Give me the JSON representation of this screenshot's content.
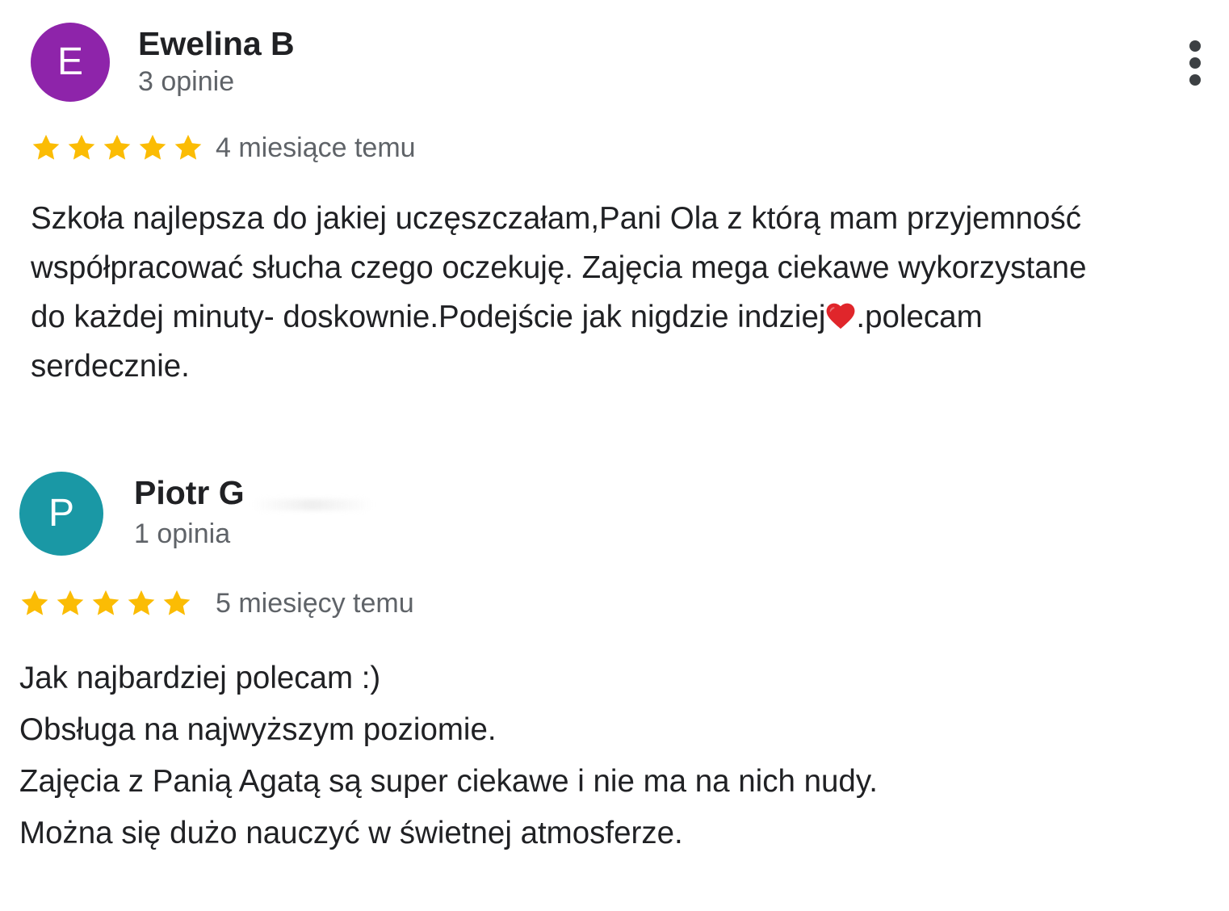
{
  "colors": {
    "avatar_purple": "#8e24aa",
    "avatar_teal": "#1a98a5",
    "star_gold": "#fbbc04",
    "text_primary": "#202124",
    "text_secondary": "#5f6368"
  },
  "reviews": [
    {
      "avatar_letter": "E",
      "name": "Ewelina B",
      "review_count": "3 opinie",
      "rating": 5,
      "time_ago": "4 miesiące temu",
      "text_lines": [
        "Szkoła najlepsza do jakiej uczęszczałam,Pani Ola z którą mam przyjemność",
        "współpracować słucha czego oczekuję. Zajęcia mega ciekawe wykorzystane",
        "do każdej minuty- doskownie.Podejście jak nigdzie indziej",
        ".polecam",
        "serdecznie."
      ],
      "has_menu": true,
      "icons": {
        "menu": "more-vertical-icon",
        "star": "star-icon",
        "emoji": "heart-icon"
      }
    },
    {
      "avatar_letter": "P",
      "name": "Piotr G",
      "review_count": "1 opinia",
      "rating": 5,
      "time_ago": "5 miesięcy temu",
      "text_lines": [
        "Jak najbardziej polecam :)",
        "Obsługa na najwyższym poziomie.",
        "Zajęcia z Panią Agatą są super ciekawe i nie ma na nich nudy.",
        "Można się dużo nauczyć w świetnej atmosferze."
      ],
      "has_menu": false,
      "icons": {
        "star": "star-icon"
      }
    }
  ]
}
